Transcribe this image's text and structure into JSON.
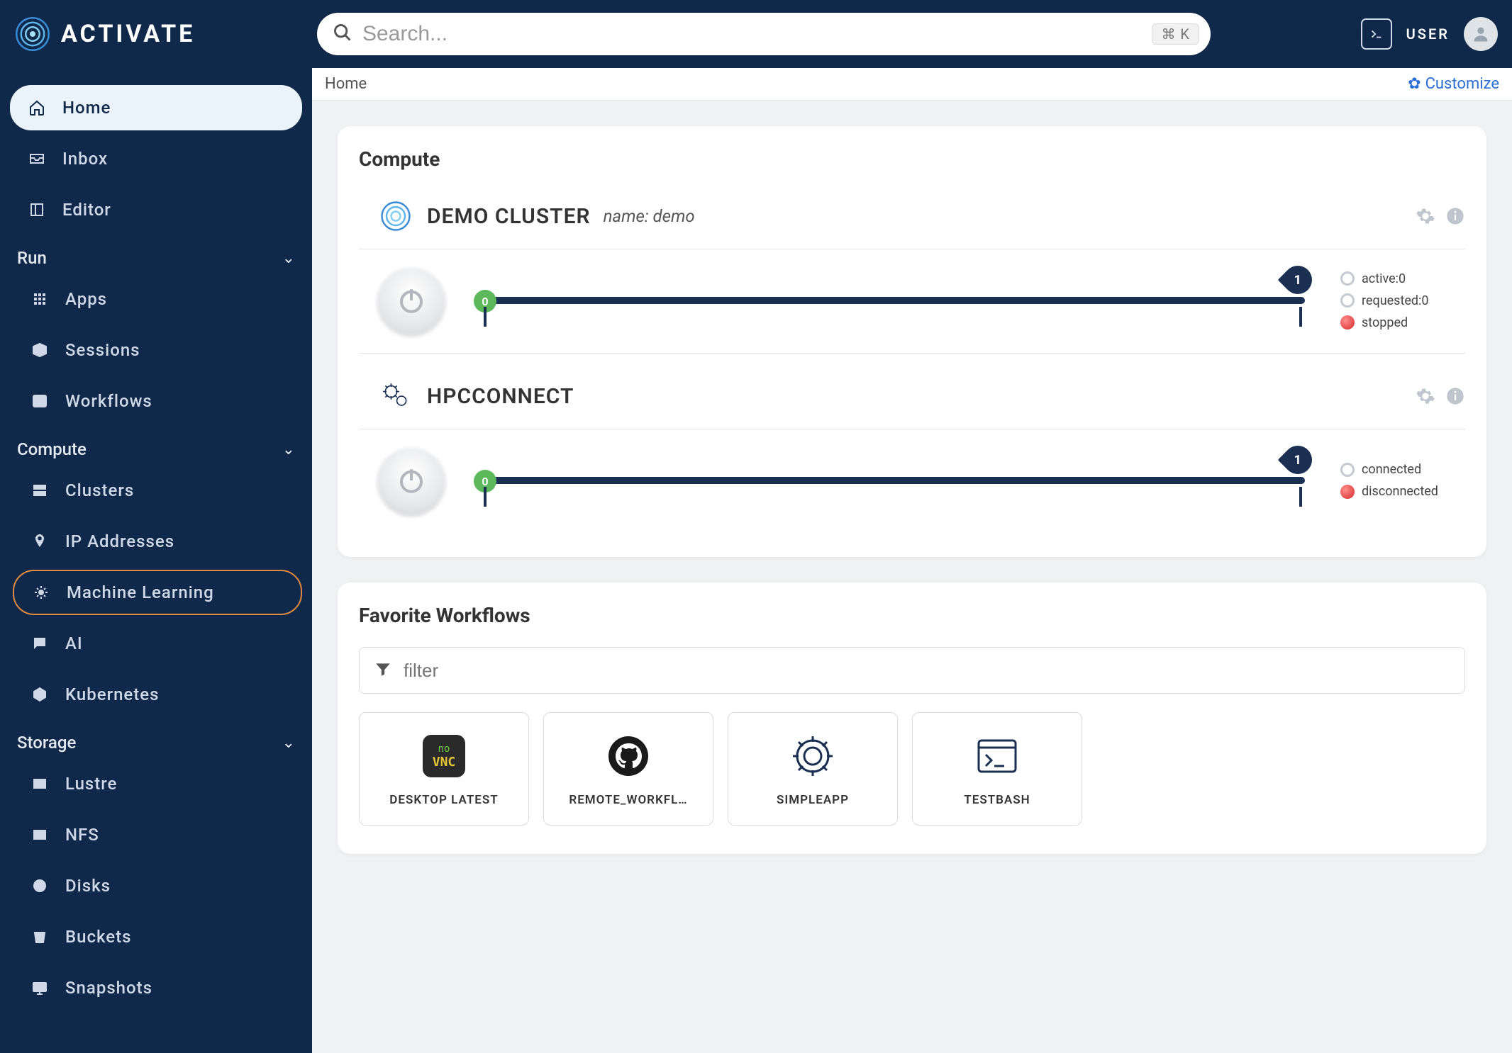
{
  "brand": "ACTIVATE",
  "search": {
    "placeholder": "Search...",
    "shortcut": "⌘ K"
  },
  "header": {
    "user_label": "USER"
  },
  "breadcrumb": "Home",
  "customize_label": "Customize",
  "sidebar": {
    "top": [
      {
        "label": "Home",
        "icon": "home"
      },
      {
        "label": "Inbox",
        "icon": "inbox"
      },
      {
        "label": "Editor",
        "icon": "editor"
      }
    ],
    "sections": [
      {
        "label": "Run",
        "items": [
          {
            "label": "Apps",
            "icon": "grid"
          },
          {
            "label": "Sessions",
            "icon": "box"
          },
          {
            "label": "Workflows",
            "icon": "flow"
          }
        ]
      },
      {
        "label": "Compute",
        "items": [
          {
            "label": "Clusters",
            "icon": "stack"
          },
          {
            "label": "IP Addresses",
            "icon": "pin"
          },
          {
            "label": "Machine Learning",
            "icon": "ml"
          },
          {
            "label": "AI",
            "icon": "chat"
          },
          {
            "label": "Kubernetes",
            "icon": "k8s"
          }
        ]
      },
      {
        "label": "Storage",
        "items": [
          {
            "label": "Lustre",
            "icon": "disk"
          },
          {
            "label": "NFS",
            "icon": "disk"
          },
          {
            "label": "Disks",
            "icon": "drive"
          },
          {
            "label": "Buckets",
            "icon": "bucket"
          },
          {
            "label": "Snapshots",
            "icon": "monitor"
          }
        ]
      }
    ]
  },
  "compute": {
    "title": "Compute",
    "cards": [
      {
        "name": "DEMO CLUSTER",
        "meta": "name: demo",
        "icon": "swirl",
        "slider": {
          "start": "0",
          "pin": "1"
        },
        "statuses": [
          {
            "label": "active:0",
            "color": "gray"
          },
          {
            "label": "requested:0",
            "color": "gray"
          },
          {
            "label": "stopped",
            "color": "red"
          }
        ]
      },
      {
        "name": "HPCCONNECT",
        "meta": "",
        "icon": "gears",
        "slider": {
          "start": "0",
          "pin": "1"
        },
        "statuses": [
          {
            "label": "connected",
            "color": "gray"
          },
          {
            "label": "disconnected",
            "color": "red"
          }
        ]
      }
    ]
  },
  "workflows": {
    "title": "Favorite Workflows",
    "filter_placeholder": "filter",
    "items": [
      {
        "label": "DESKTOP LATEST",
        "icon": "novnc"
      },
      {
        "label": "REMOTE_WORKFL…",
        "icon": "github"
      },
      {
        "label": "SIMPLEAPP",
        "icon": "gear"
      },
      {
        "label": "TESTBASH",
        "icon": "terminal"
      }
    ]
  }
}
